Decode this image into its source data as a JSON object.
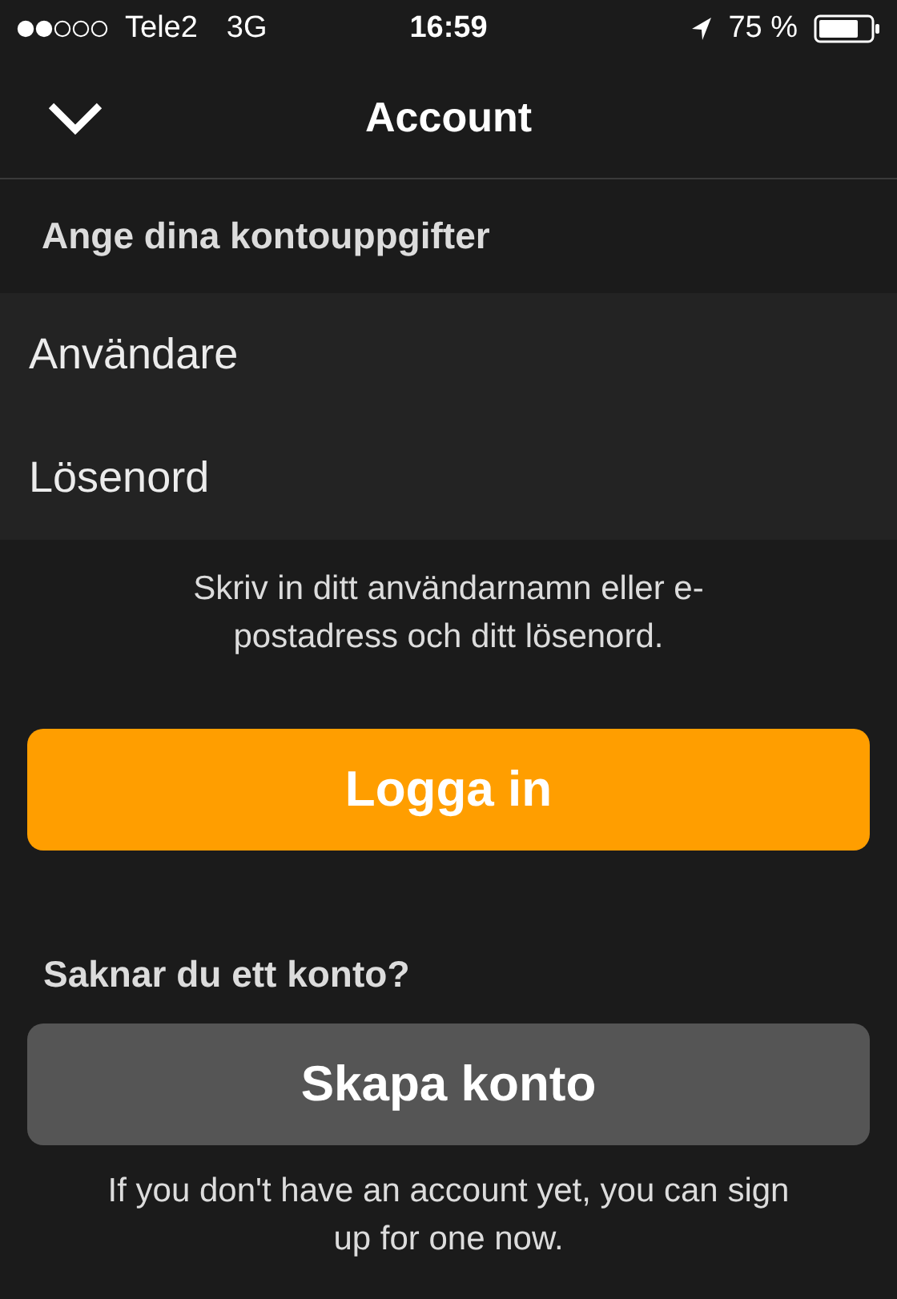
{
  "status_bar": {
    "carrier": "Tele2",
    "network": "3G",
    "time": "16:59",
    "battery": "75 %"
  },
  "nav": {
    "title": "Account"
  },
  "section_header": "Ange dina kontouppgifter",
  "fields": [
    {
      "placeholder": "Användare"
    },
    {
      "placeholder": "Lösenord"
    }
  ],
  "help_text": "Skriv in ditt användarnamn eller e-postadress och ditt lösenord.",
  "login_button": "Logga in",
  "signup_prompt": "Saknar du ett konto?",
  "signup_button": "Skapa konto",
  "signup_hint": "If you don't have an account yet, you can sign up for one now."
}
